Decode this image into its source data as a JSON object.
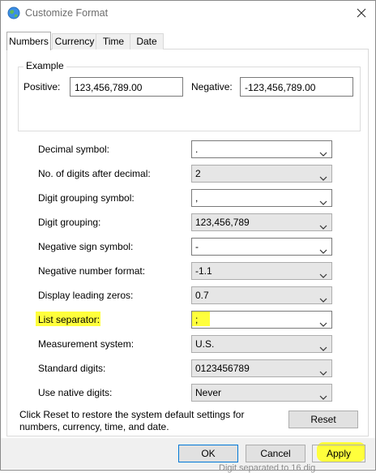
{
  "window": {
    "title": "Customize Format"
  },
  "tabs": [
    {
      "label": "Numbers",
      "active": true
    },
    {
      "label": "Currency",
      "active": false
    },
    {
      "label": "Time",
      "active": false
    },
    {
      "label": "Date",
      "active": false
    }
  ],
  "example": {
    "group_label": "Example",
    "positive_label": "Positive:",
    "positive_value": "123,456,789.00",
    "negative_label": "Negative:",
    "negative_value": "-123,456,789.00"
  },
  "settings": [
    {
      "label": "Decimal symbol:",
      "value": ".",
      "editable": true
    },
    {
      "label": "No. of digits after decimal:",
      "value": "2",
      "editable": false
    },
    {
      "label": "Digit grouping symbol:",
      "value": ",",
      "editable": true
    },
    {
      "label": "Digit grouping:",
      "value": "123,456,789",
      "editable": false
    },
    {
      "label": "Negative sign symbol:",
      "value": "-",
      "editable": true
    },
    {
      "label": "Negative number format:",
      "value": "-1.1",
      "editable": false
    },
    {
      "label": "Display leading zeros:",
      "value": "0.7",
      "editable": false
    },
    {
      "label": "List separator:",
      "value": ";",
      "editable": true,
      "highlighted": true
    },
    {
      "label": "Measurement system:",
      "value": "U.S.",
      "editable": false
    },
    {
      "label": "Standard digits:",
      "value": "0123456789",
      "editable": false
    },
    {
      "label": "Use native digits:",
      "value": "Never",
      "editable": false
    }
  ],
  "reset": {
    "note": "Click Reset to restore the system default settings for numbers, currency, time, and date.",
    "button_label": "Reset"
  },
  "footer": {
    "ok_label": "OK",
    "cancel_label": "Cancel",
    "apply_label": "Apply"
  },
  "background_partial_text": "Digit separated to 16 dig",
  "colors": {
    "highlight": "#ffff3c",
    "focus_border": "#0078d7"
  },
  "icons": {
    "app": "globe-icon",
    "close": "close-icon",
    "dropdown": "chevron-down-icon"
  }
}
